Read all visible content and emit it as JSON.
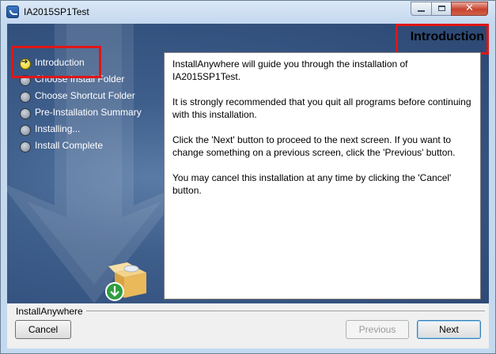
{
  "window": {
    "title": "IA2015SP1Test"
  },
  "header": {
    "title": "Introduction"
  },
  "steps": [
    {
      "label": "Introduction",
      "current": true
    },
    {
      "label": "Choose Install Folder",
      "current": false
    },
    {
      "label": "Choose Shortcut Folder",
      "current": false
    },
    {
      "label": "Pre-Installation Summary",
      "current": false
    },
    {
      "label": "Installing...",
      "current": false
    },
    {
      "label": "Install Complete",
      "current": false
    }
  ],
  "content": {
    "paragraphs": [
      "InstallAnywhere will guide you through the installation of IA2015SP1Test.",
      "It is strongly recommended that you quit all programs before continuing with this installation.",
      "Click the 'Next' button to proceed to the next screen. If you want to change something on a previous screen, click the 'Previous' button.",
      "You may cancel this installation at any time by clicking the 'Cancel' button."
    ]
  },
  "footer": {
    "brand": "InstallAnywhere",
    "cancel_label": "Cancel",
    "previous_label": "Previous",
    "next_label": "Next"
  },
  "icons": {
    "app": "installanywhere-app-icon",
    "product": "box-with-download-icon"
  },
  "colors": {
    "highlight": "#e01616",
    "banner": "#3e5e8b"
  }
}
